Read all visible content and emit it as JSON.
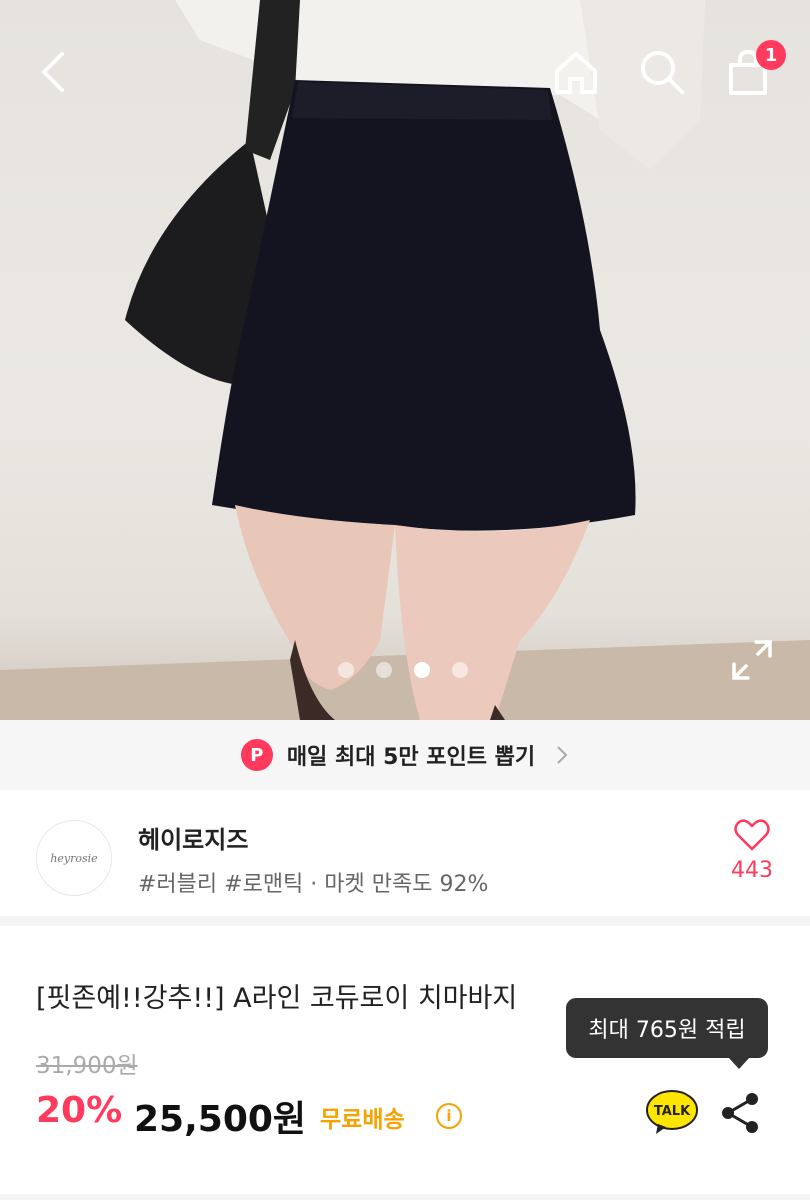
{
  "header": {
    "cart_badge": "1",
    "slide_count": 4,
    "active_slide": 3
  },
  "point_banner": {
    "badge": "P",
    "text": "매일 최대 5만 포인트 뽑기"
  },
  "shop": {
    "logo_text": "heyrosie",
    "name": "헤이로지즈",
    "tags": "#러블리 #로맨틱 · 마켓 만족도 92%",
    "like_count": "443"
  },
  "product": {
    "title": "[핏존예!!강추!!] A라인 코듀로이 치마바지",
    "original_price": "31,900원",
    "discount": "20%",
    "price": "25,500원",
    "shipping": "무료배송",
    "info_symbol": "i",
    "tooltip": "최대 765원 적립",
    "talk_label": "TALK"
  },
  "colors": {
    "accent": "#ff3a5c",
    "shipping": "#f5a300",
    "kakao": "#fee500"
  }
}
